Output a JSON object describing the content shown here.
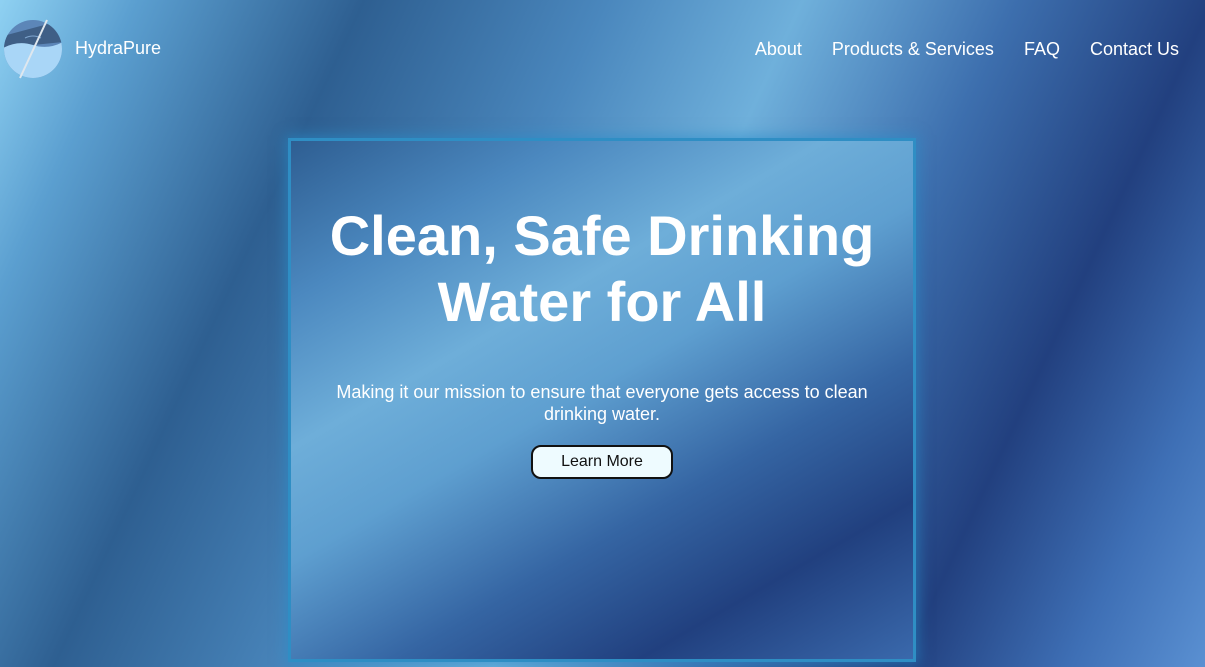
{
  "brand": {
    "name": "HydraPure",
    "logo_icon": "water-globe-icon"
  },
  "nav": {
    "items": [
      {
        "label": "About"
      },
      {
        "label": "Products & Services"
      },
      {
        "label": "FAQ"
      },
      {
        "label": "Contact Us"
      }
    ]
  },
  "hero": {
    "title_line1": "Clean, Safe Drinking",
    "title_line2": "Water for All",
    "subtitle": "Making it our mission to ensure that everyone gets access to clean drinking water.",
    "button_label": "Learn More"
  },
  "colors": {
    "text": "#ffffff",
    "accent_border": "#2f8ec4",
    "button_bg": "#eefbff",
    "button_border": "#111111"
  }
}
